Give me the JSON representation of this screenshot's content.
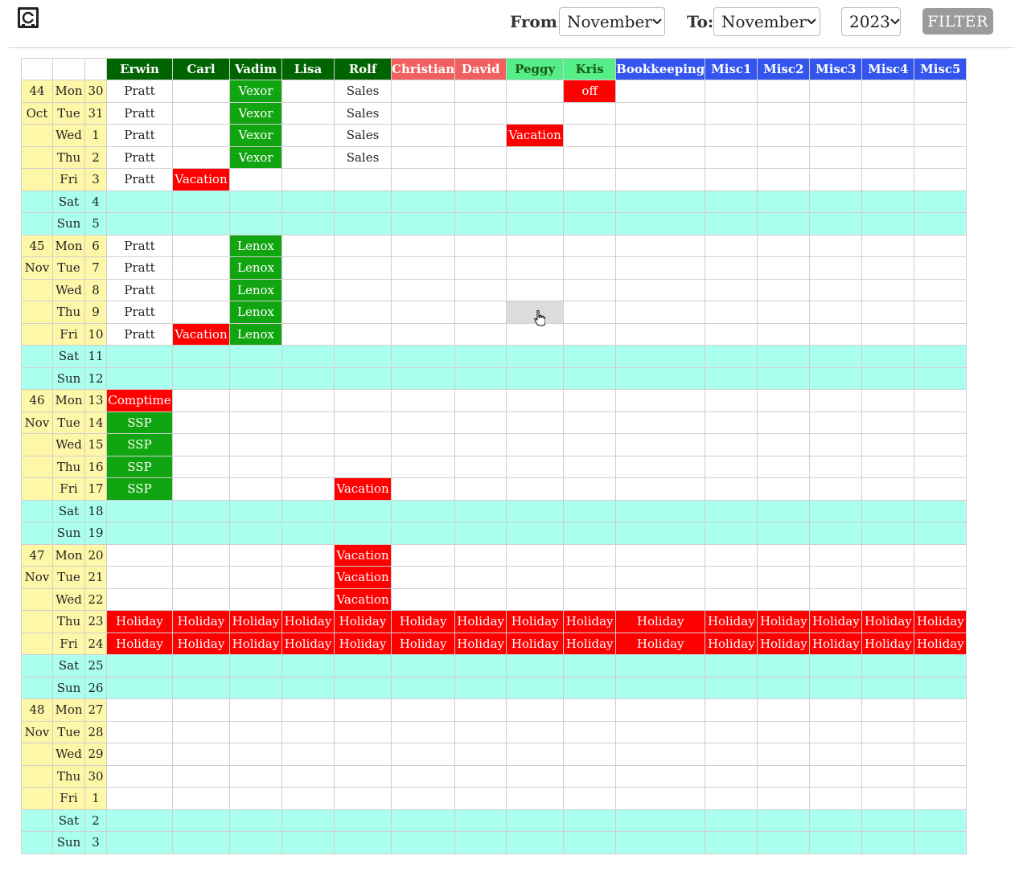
{
  "logo_icon": "calendar-safe-icon",
  "filter": {
    "from_label": "From:",
    "from_value": "November",
    "to_label": "To:",
    "to_value": "November",
    "year_value": "2023",
    "button_label": "FILTER"
  },
  "columns": [
    {
      "name": "Erwin",
      "color": "#006400"
    },
    {
      "name": "Carl",
      "color": "#006400"
    },
    {
      "name": "Vadim",
      "color": "#006400"
    },
    {
      "name": "Lisa",
      "color": "#006400"
    },
    {
      "name": "Rolf",
      "color": "#006400"
    },
    {
      "name": "Christian",
      "color": "#f06060"
    },
    {
      "name": "David",
      "color": "#f06060"
    },
    {
      "name": "Peggy",
      "color": "#55ee88"
    },
    {
      "name": "Kris",
      "color": "#55ee88"
    },
    {
      "name": "Bookkeeping",
      "color": "#3355ee"
    },
    {
      "name": "Misc1",
      "color": "#3355ee"
    },
    {
      "name": "Misc2",
      "color": "#3355ee"
    },
    {
      "name": "Misc3",
      "color": "#3355ee"
    },
    {
      "name": "Misc4",
      "color": "#3355ee"
    },
    {
      "name": "Misc5",
      "color": "#3355ee"
    }
  ],
  "colors": {
    "event_red": "#ff0000",
    "event_green": "#11a611",
    "weekend": "#aaffee",
    "week_cell": "#fff7a8"
  },
  "rows": [
    {
      "week": "44",
      "day": "Mon",
      "date": "30",
      "cells": [
        [
          "Pratt",
          ""
        ],
        [
          "",
          ""
        ],
        [
          "Vexor",
          "green"
        ],
        [
          "",
          ""
        ],
        [
          "Sales",
          ""
        ],
        [
          "",
          ""
        ],
        [
          "",
          ""
        ],
        [
          "",
          ""
        ],
        [
          "off",
          "red"
        ],
        [
          "",
          ""
        ],
        [
          "",
          ""
        ],
        [
          "",
          ""
        ],
        [
          "",
          ""
        ],
        [
          "",
          ""
        ],
        [
          "",
          ""
        ]
      ]
    },
    {
      "week": "Oct",
      "day": "Tue",
      "date": "31",
      "cells": [
        [
          "Pratt",
          ""
        ],
        [
          "",
          ""
        ],
        [
          "Vexor",
          "green"
        ],
        [
          "",
          ""
        ],
        [
          "Sales",
          ""
        ],
        [
          "",
          ""
        ],
        [
          "",
          ""
        ],
        [
          "",
          ""
        ],
        [
          "",
          ""
        ],
        [
          "",
          ""
        ],
        [
          "",
          ""
        ],
        [
          "",
          ""
        ],
        [
          "",
          ""
        ],
        [
          "",
          ""
        ],
        [
          "",
          ""
        ]
      ]
    },
    {
      "week": "",
      "day": "Wed",
      "date": "1",
      "cells": [
        [
          "Pratt",
          ""
        ],
        [
          "",
          ""
        ],
        [
          "Vexor",
          "green"
        ],
        [
          "",
          ""
        ],
        [
          "Sales",
          ""
        ],
        [
          "",
          ""
        ],
        [
          "",
          ""
        ],
        [
          "Vacation",
          "red"
        ],
        [
          "",
          ""
        ],
        [
          "",
          ""
        ],
        [
          "",
          ""
        ],
        [
          "",
          ""
        ],
        [
          "",
          ""
        ],
        [
          "",
          ""
        ],
        [
          "",
          ""
        ]
      ]
    },
    {
      "week": "",
      "day": "Thu",
      "date": "2",
      "cells": [
        [
          "Pratt",
          ""
        ],
        [
          "",
          ""
        ],
        [
          "Vexor",
          "green"
        ],
        [
          "",
          ""
        ],
        [
          "Sales",
          ""
        ],
        [
          "",
          ""
        ],
        [
          "",
          ""
        ],
        [
          "",
          ""
        ],
        [
          "",
          ""
        ],
        [
          "",
          ""
        ],
        [
          "",
          ""
        ],
        [
          "",
          ""
        ],
        [
          "",
          ""
        ],
        [
          "",
          ""
        ],
        [
          "",
          ""
        ]
      ]
    },
    {
      "week": "",
      "day": "Fri",
      "date": "3",
      "cells": [
        [
          "Pratt",
          ""
        ],
        [
          "Vacation",
          "red"
        ],
        [
          "",
          ""
        ],
        [
          "",
          ""
        ],
        [
          "",
          ""
        ],
        [
          "",
          ""
        ],
        [
          "",
          ""
        ],
        [
          "",
          ""
        ],
        [
          "",
          ""
        ],
        [
          "",
          ""
        ],
        [
          "",
          ""
        ],
        [
          "",
          ""
        ],
        [
          "",
          ""
        ],
        [
          "",
          ""
        ],
        [
          "",
          ""
        ]
      ]
    },
    {
      "week": "",
      "day": "Sat",
      "date": "4",
      "weekend": true
    },
    {
      "week": "",
      "day": "Sun",
      "date": "5",
      "weekend": true
    },
    {
      "week": "45",
      "day": "Mon",
      "date": "6",
      "cells": [
        [
          "Pratt",
          ""
        ],
        [
          "",
          ""
        ],
        [
          "Lenox",
          "green"
        ],
        [
          "",
          ""
        ],
        [
          "",
          ""
        ],
        [
          "",
          ""
        ],
        [
          "",
          ""
        ],
        [
          "",
          ""
        ],
        [
          "",
          ""
        ],
        [
          "",
          ""
        ],
        [
          "",
          ""
        ],
        [
          "",
          ""
        ],
        [
          "",
          ""
        ],
        [
          "",
          ""
        ],
        [
          "",
          ""
        ]
      ]
    },
    {
      "week": "Nov",
      "day": "Tue",
      "date": "7",
      "cells": [
        [
          "Pratt",
          ""
        ],
        [
          "",
          ""
        ],
        [
          "Lenox",
          "green"
        ],
        [
          "",
          ""
        ],
        [
          "",
          ""
        ],
        [
          "",
          ""
        ],
        [
          "",
          ""
        ],
        [
          "",
          ""
        ],
        [
          "",
          ""
        ],
        [
          "",
          ""
        ],
        [
          "",
          ""
        ],
        [
          "",
          ""
        ],
        [
          "",
          ""
        ],
        [
          "",
          ""
        ],
        [
          "",
          ""
        ]
      ]
    },
    {
      "week": "",
      "day": "Wed",
      "date": "8",
      "cells": [
        [
          "Pratt",
          ""
        ],
        [
          "",
          ""
        ],
        [
          "Lenox",
          "green"
        ],
        [
          "",
          ""
        ],
        [
          "",
          ""
        ],
        [
          "",
          ""
        ],
        [
          "",
          ""
        ],
        [
          "",
          ""
        ],
        [
          "",
          ""
        ],
        [
          "",
          ""
        ],
        [
          "",
          ""
        ],
        [
          "",
          ""
        ],
        [
          "",
          ""
        ],
        [
          "",
          ""
        ],
        [
          "",
          ""
        ]
      ]
    },
    {
      "week": "",
      "day": "Thu",
      "date": "9",
      "cells": [
        [
          "Pratt",
          ""
        ],
        [
          "",
          ""
        ],
        [
          "Lenox",
          "green"
        ],
        [
          "",
          ""
        ],
        [
          "",
          ""
        ],
        [
          "",
          ""
        ],
        [
          "",
          ""
        ],
        [
          "",
          "hover"
        ],
        [
          "",
          ""
        ],
        [
          "",
          ""
        ],
        [
          "",
          ""
        ],
        [
          "",
          ""
        ],
        [
          "",
          ""
        ],
        [
          "",
          ""
        ],
        [
          "",
          ""
        ]
      ]
    },
    {
      "week": "",
      "day": "Fri",
      "date": "10",
      "cells": [
        [
          "Pratt",
          ""
        ],
        [
          "Vacation",
          "red"
        ],
        [
          "Lenox",
          "green"
        ],
        [
          "",
          ""
        ],
        [
          "",
          ""
        ],
        [
          "",
          ""
        ],
        [
          "",
          ""
        ],
        [
          "",
          ""
        ],
        [
          "",
          ""
        ],
        [
          "",
          ""
        ],
        [
          "",
          ""
        ],
        [
          "",
          ""
        ],
        [
          "",
          ""
        ],
        [
          "",
          ""
        ],
        [
          "",
          ""
        ]
      ]
    },
    {
      "week": "",
      "day": "Sat",
      "date": "11",
      "weekend": true
    },
    {
      "week": "",
      "day": "Sun",
      "date": "12",
      "weekend": true
    },
    {
      "week": "46",
      "day": "Mon",
      "date": "13",
      "cells": [
        [
          "Comptime",
          "red"
        ],
        [
          "",
          ""
        ],
        [
          "",
          ""
        ],
        [
          "",
          ""
        ],
        [
          "",
          ""
        ],
        [
          "",
          ""
        ],
        [
          "",
          ""
        ],
        [
          "",
          ""
        ],
        [
          "",
          ""
        ],
        [
          "",
          ""
        ],
        [
          "",
          ""
        ],
        [
          "",
          ""
        ],
        [
          "",
          ""
        ],
        [
          "",
          ""
        ],
        [
          "",
          ""
        ]
      ]
    },
    {
      "week": "Nov",
      "day": "Tue",
      "date": "14",
      "cells": [
        [
          "SSP",
          "green"
        ],
        [
          "",
          ""
        ],
        [
          "",
          ""
        ],
        [
          "",
          ""
        ],
        [
          "",
          ""
        ],
        [
          "",
          ""
        ],
        [
          "",
          ""
        ],
        [
          "",
          ""
        ],
        [
          "",
          ""
        ],
        [
          "",
          ""
        ],
        [
          "",
          ""
        ],
        [
          "",
          ""
        ],
        [
          "",
          ""
        ],
        [
          "",
          ""
        ],
        [
          "",
          ""
        ]
      ]
    },
    {
      "week": "",
      "day": "Wed",
      "date": "15",
      "cells": [
        [
          "SSP",
          "green"
        ],
        [
          "",
          ""
        ],
        [
          "",
          ""
        ],
        [
          "",
          ""
        ],
        [
          "",
          ""
        ],
        [
          "",
          ""
        ],
        [
          "",
          ""
        ],
        [
          "",
          ""
        ],
        [
          "",
          ""
        ],
        [
          "",
          ""
        ],
        [
          "",
          ""
        ],
        [
          "",
          ""
        ],
        [
          "",
          ""
        ],
        [
          "",
          ""
        ],
        [
          "",
          ""
        ]
      ]
    },
    {
      "week": "",
      "day": "Thu",
      "date": "16",
      "cells": [
        [
          "SSP",
          "green"
        ],
        [
          "",
          ""
        ],
        [
          "",
          ""
        ],
        [
          "",
          ""
        ],
        [
          "",
          ""
        ],
        [
          "",
          ""
        ],
        [
          "",
          ""
        ],
        [
          "",
          ""
        ],
        [
          "",
          ""
        ],
        [
          "",
          ""
        ],
        [
          "",
          ""
        ],
        [
          "",
          ""
        ],
        [
          "",
          ""
        ],
        [
          "",
          ""
        ],
        [
          "",
          ""
        ]
      ]
    },
    {
      "week": "",
      "day": "Fri",
      "date": "17",
      "cells": [
        [
          "SSP",
          "green"
        ],
        [
          "",
          ""
        ],
        [
          "",
          ""
        ],
        [
          "",
          ""
        ],
        [
          "Vacation",
          "red"
        ],
        [
          "",
          ""
        ],
        [
          "",
          ""
        ],
        [
          "",
          ""
        ],
        [
          "",
          ""
        ],
        [
          "",
          ""
        ],
        [
          "",
          ""
        ],
        [
          "",
          ""
        ],
        [
          "",
          ""
        ],
        [
          "",
          ""
        ],
        [
          "",
          ""
        ]
      ]
    },
    {
      "week": "",
      "day": "Sat",
      "date": "18",
      "weekend": true
    },
    {
      "week": "",
      "day": "Sun",
      "date": "19",
      "weekend": true
    },
    {
      "week": "47",
      "day": "Mon",
      "date": "20",
      "cells": [
        [
          "",
          ""
        ],
        [
          "",
          ""
        ],
        [
          "",
          ""
        ],
        [
          "",
          ""
        ],
        [
          "Vacation",
          "red"
        ],
        [
          "",
          ""
        ],
        [
          "",
          ""
        ],
        [
          "",
          ""
        ],
        [
          "",
          ""
        ],
        [
          "",
          ""
        ],
        [
          "",
          ""
        ],
        [
          "",
          ""
        ],
        [
          "",
          ""
        ],
        [
          "",
          ""
        ],
        [
          "",
          ""
        ]
      ]
    },
    {
      "week": "Nov",
      "day": "Tue",
      "date": "21",
      "cells": [
        [
          "",
          ""
        ],
        [
          "",
          ""
        ],
        [
          "",
          ""
        ],
        [
          "",
          ""
        ],
        [
          "Vacation",
          "red"
        ],
        [
          "",
          ""
        ],
        [
          "",
          ""
        ],
        [
          "",
          ""
        ],
        [
          "",
          ""
        ],
        [
          "",
          ""
        ],
        [
          "",
          ""
        ],
        [
          "",
          ""
        ],
        [
          "",
          ""
        ],
        [
          "",
          ""
        ],
        [
          "",
          ""
        ]
      ]
    },
    {
      "week": "",
      "day": "Wed",
      "date": "22",
      "cells": [
        [
          "",
          ""
        ],
        [
          "",
          ""
        ],
        [
          "",
          ""
        ],
        [
          "",
          ""
        ],
        [
          "Vacation",
          "red"
        ],
        [
          "",
          ""
        ],
        [
          "",
          ""
        ],
        [
          "",
          ""
        ],
        [
          "",
          ""
        ],
        [
          "",
          ""
        ],
        [
          "",
          ""
        ],
        [
          "",
          ""
        ],
        [
          "",
          ""
        ],
        [
          "",
          ""
        ],
        [
          "",
          ""
        ]
      ]
    },
    {
      "week": "",
      "day": "Thu",
      "date": "23",
      "cells": [
        [
          "Holiday",
          "red"
        ],
        [
          "Holiday",
          "red"
        ],
        [
          "Holiday",
          "red"
        ],
        [
          "Holiday",
          "red"
        ],
        [
          "Holiday",
          "red"
        ],
        [
          "Holiday",
          "red"
        ],
        [
          "Holiday",
          "red"
        ],
        [
          "Holiday",
          "red"
        ],
        [
          "Holiday",
          "red"
        ],
        [
          "Holiday",
          "red"
        ],
        [
          "Holiday",
          "red"
        ],
        [
          "Holiday",
          "red"
        ],
        [
          "Holiday",
          "red"
        ],
        [
          "Holiday",
          "red"
        ],
        [
          "Holiday",
          "red"
        ]
      ]
    },
    {
      "week": "",
      "day": "Fri",
      "date": "24",
      "cells": [
        [
          "Holiday",
          "red"
        ],
        [
          "Holiday",
          "red"
        ],
        [
          "Holiday",
          "red"
        ],
        [
          "Holiday",
          "red"
        ],
        [
          "Holiday",
          "red"
        ],
        [
          "Holiday",
          "red"
        ],
        [
          "Holiday",
          "red"
        ],
        [
          "Holiday",
          "red"
        ],
        [
          "Holiday",
          "red"
        ],
        [
          "Holiday",
          "red"
        ],
        [
          "Holiday",
          "red"
        ],
        [
          "Holiday",
          "red"
        ],
        [
          "Holiday",
          "red"
        ],
        [
          "Holiday",
          "red"
        ],
        [
          "Holiday",
          "red"
        ]
      ]
    },
    {
      "week": "",
      "day": "Sat",
      "date": "25",
      "weekend": true
    },
    {
      "week": "",
      "day": "Sun",
      "date": "26",
      "weekend": true
    },
    {
      "week": "48",
      "day": "Mon",
      "date": "27",
      "cells": []
    },
    {
      "week": "Nov",
      "day": "Tue",
      "date": "28",
      "cells": []
    },
    {
      "week": "",
      "day": "Wed",
      "date": "29",
      "cells": []
    },
    {
      "week": "",
      "day": "Thu",
      "date": "30",
      "cells": []
    },
    {
      "week": "",
      "day": "Fri",
      "date": "1",
      "cells": []
    },
    {
      "week": "",
      "day": "Sat",
      "date": "2",
      "weekend": true
    },
    {
      "week": "",
      "day": "Sun",
      "date": "3",
      "weekend": true
    }
  ]
}
